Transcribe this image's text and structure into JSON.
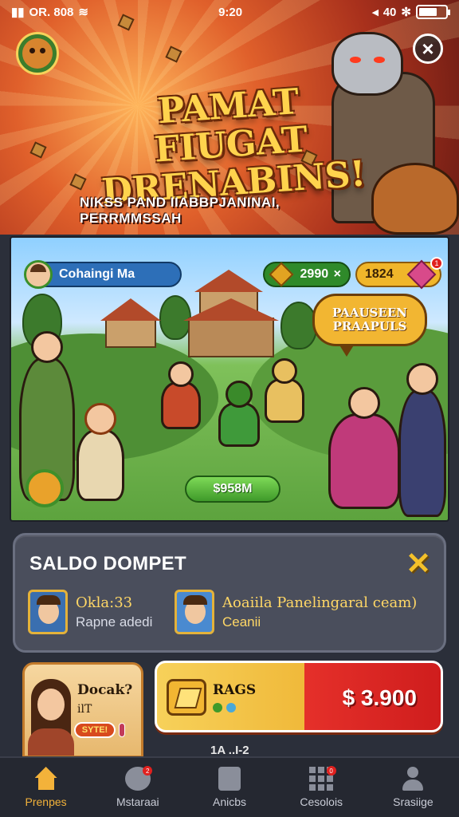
{
  "status_bar": {
    "carrier": "OR. 808",
    "time": "9:20",
    "signal_text": "40"
  },
  "banner": {
    "title": "PAMAT FIUGAT DRENABINS!",
    "subtitle": "NIKSS PAND IIABBPJANINAI, PERRMMSSAH",
    "close_label": "×"
  },
  "scene": {
    "player_name": "Cohaingi Ma",
    "gems": "2990",
    "gems_action": "×",
    "coins": "1824",
    "coins_badge": "1",
    "speech_bubble": "PAAUSEEN PRAAPULS",
    "claim_button": "$958M"
  },
  "wallet": {
    "title": "SALDO DOMPET",
    "close_label": "✕",
    "friends": [
      {
        "name": "Okla:33",
        "sub": "Rapne adedi"
      },
      {
        "name": "Aoaiila Panelingaral ceam)",
        "sub": "Ceanii"
      }
    ]
  },
  "offer_left": {
    "title": "Docak?",
    "line2": "ilT",
    "badge": "SYTE!"
  },
  "offer_right": {
    "label": "RAGS",
    "amount": "$ 3.900"
  },
  "peek_text": "1A ..I-2",
  "nav": {
    "items": [
      {
        "label": "Prenpes",
        "icon": "home-icon",
        "active": true
      },
      {
        "label": "Mstaraai",
        "icon": "chat-icon",
        "badge": "2"
      },
      {
        "label": "Anicbs",
        "icon": "mail-icon"
      },
      {
        "label": "Cesolois",
        "icon": "grid-icon",
        "badge": "0"
      },
      {
        "label": "Srasiige",
        "icon": "user-icon"
      }
    ]
  },
  "colors": {
    "accent": "#f3b23a",
    "panel": "#4a4e5c",
    "nav_bg": "#252831",
    "offer_red": "#e5302a"
  }
}
